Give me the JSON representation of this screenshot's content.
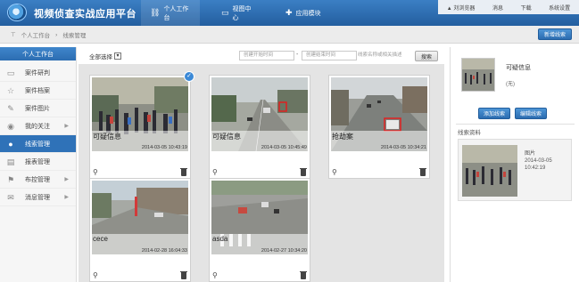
{
  "header": {
    "app_title": "视频侦查实战应用平台",
    "nav": [
      {
        "label": "个人工作台",
        "icon": "chain-icon",
        "active": true
      },
      {
        "label": "视图中心",
        "icon": "video-icon",
        "active": false
      },
      {
        "label": "应用模块",
        "icon": "puzzle-icon",
        "active": false
      }
    ],
    "top_links": [
      "▲ 刘浏览器",
      "消息",
      "下载",
      "系统设置"
    ]
  },
  "toolbar": {
    "breadcrumb": [
      "个人工作台",
      "线索管理"
    ],
    "create_button": "新增线索"
  },
  "sidebar": {
    "title": "个人工作台",
    "items": [
      {
        "label": "案件研判",
        "icon": "monitor-icon"
      },
      {
        "label": "案件档案",
        "icon": "star-icon"
      },
      {
        "label": "案件图片",
        "icon": "edit-icon"
      },
      {
        "label": "我的关注",
        "icon": "eye-icon",
        "has_arrow": true
      },
      {
        "label": "线索管理",
        "icon": "user-icon",
        "active": true
      },
      {
        "label": "报表管理",
        "icon": "report-icon"
      },
      {
        "label": "布控管理",
        "icon": "flag-icon",
        "has_arrow": true
      },
      {
        "label": "消息管理",
        "icon": "message-icon",
        "has_arrow": true
      }
    ]
  },
  "filter": {
    "select_all_label": "全部选择",
    "select_all_mark": "▾",
    "start_time_placeholder": "创建开始时间",
    "end_time_placeholder": "创建结束时间",
    "keyword_placeholder": "线索名称或相关描述",
    "search_button": "搜索"
  },
  "cards": [
    {
      "name": "可疑信息",
      "time": "2014-03-05 10:43:19",
      "selected": true
    },
    {
      "name": "可疑信息",
      "time": "2014-03-05 10:45:49",
      "selected": false
    },
    {
      "name": "抢劫案",
      "time": "2014-03-05 10:34:21",
      "selected": false
    },
    {
      "name": "cece",
      "time": "2014-02-28 16:04:33",
      "selected": false
    },
    {
      "name": "asda",
      "time": "2014-02-27 10:34:20",
      "selected": false
    }
  ],
  "right_panel": {
    "title": "可疑信息",
    "subtitle": "(无)",
    "buttons": [
      "添加线索",
      "编辑线索"
    ],
    "section_title": "线索资料",
    "item": {
      "label": "图片",
      "date": "2014-03-05",
      "time": "10:42:19"
    }
  },
  "colors": {
    "header_blue": "#2b6cb0",
    "active_blue": "#2f72b8",
    "grid_bg": "#e4e4e4"
  }
}
